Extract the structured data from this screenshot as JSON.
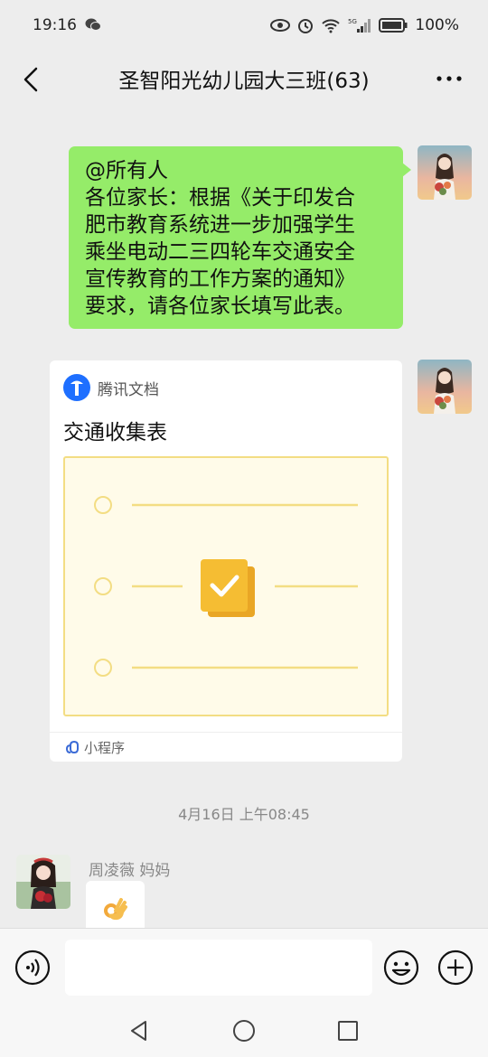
{
  "status_bar": {
    "time": "19:16",
    "battery": "100%"
  },
  "header": {
    "title": "圣智阳光幼儿园大三班(63)"
  },
  "messages": {
    "outgoing_text": {
      "lines": [
        "@所有人",
        "各位家长：根据《关于印发合",
        "肥市教育系统进一步加强学生",
        "乘坐电动二三四轮车交通安全",
        "宣传教育的工作方案的通知》",
        "要求，请各位家长填写此表。"
      ]
    },
    "mini_program_card": {
      "source": "腾讯文档",
      "title": "交通收集表",
      "footer": "小程序"
    },
    "timestamp": "4月16日 上午08:45",
    "incoming": {
      "sender": "周凌薇  妈妈",
      "emoji": "ok-hand"
    }
  },
  "input_bar": {
    "placeholder": ""
  },
  "colors": {
    "bubble_green": "#95ec69",
    "background": "#ededed",
    "card_preview_bg": "#fffbe9",
    "card_preview_border": "#f3dd83",
    "tencent_docs_blue": "#1e6fff"
  }
}
